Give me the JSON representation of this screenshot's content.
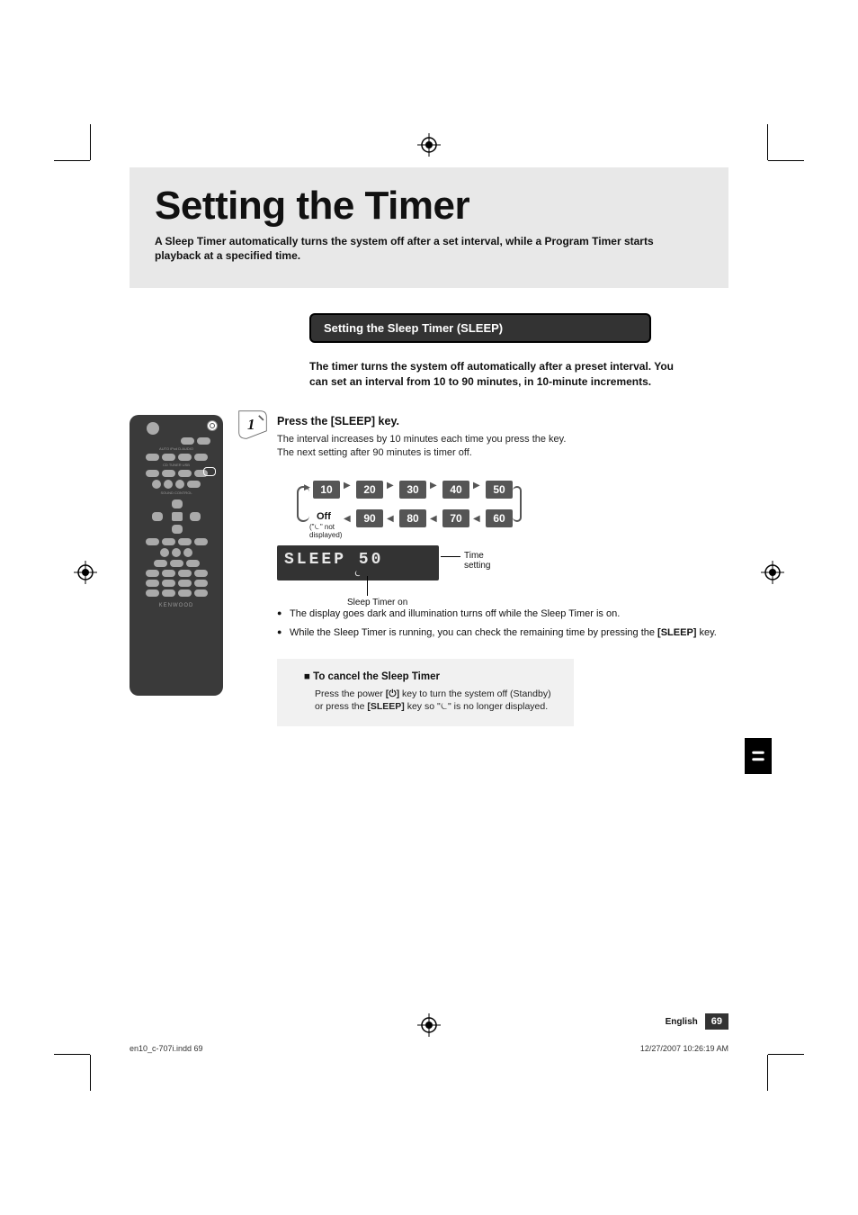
{
  "hero": {
    "title": "Setting the Timer",
    "description": "A Sleep Timer automatically turns the system off after a set interval, while a Program Timer starts playback at a specified time."
  },
  "section": {
    "bar": "Setting the Sleep Timer (SLEEP)",
    "intro": "The timer turns the system off automatically after a preset interval. You can set an interval from 10 to 90 minutes, in 10-minute increments."
  },
  "step1": {
    "number": "1",
    "heading": "Press the [SLEEP] key.",
    "line1": "The interval increases by 10 minutes each time you press the key.",
    "line2": "The next setting after 90 minutes is timer off."
  },
  "cycle": {
    "top": [
      "10",
      "20",
      "30",
      "40",
      "50"
    ],
    "bot": [
      "90",
      "80",
      "70",
      "60"
    ],
    "off_label": "Off",
    "off_sub": "(\"⏾\" not displayed)"
  },
  "lcd": {
    "text": "SLEEP  50",
    "icon_alt": "⏾",
    "caption_time": "Time setting",
    "caption_on": "Sleep Timer on"
  },
  "bullets": {
    "b1": "The display goes dark and illumination turns off while the Sleep Timer is on.",
    "b2_a": "While the Sleep Timer is running, you can check the remaining time by pressing the ",
    "b2_key": "[SLEEP]",
    "b2_b": " key."
  },
  "note": {
    "heading": "To cancel the Sleep Timer",
    "body_a": "Press the power ",
    "body_key1": "[⏻]",
    "body_b": " key to turn the system off (Standby) or press the ",
    "body_key2": "[SLEEP]",
    "body_c": " key so \"⏾\" is no longer displayed."
  },
  "remote": {
    "brand": "KENWOOD"
  },
  "footer": {
    "lang": "English",
    "page": "69",
    "print_left": "en10_c-707i.indd   69",
    "print_right": "12/27/2007   10:26:19 AM"
  }
}
